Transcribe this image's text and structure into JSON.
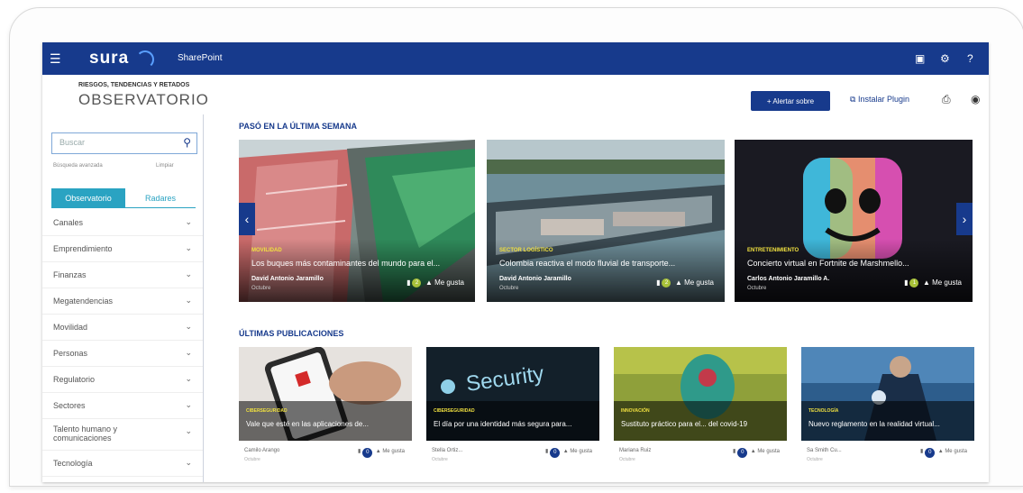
{
  "topbar": {
    "brand": "sura",
    "product": "SharePoint",
    "waffle_icon": "waffle-icon",
    "icons": [
      "mobile-icon",
      "settings-icon",
      "help-icon"
    ]
  },
  "header": {
    "subtitle": "RIESGOS, TENDENCIAS Y RETADOS",
    "title": "OBSERVATORIO",
    "primary_button": "+ Alertar sobre",
    "install_link": "Instalar Plugin"
  },
  "sidebar": {
    "search_placeholder": "Buscar",
    "advanced": "Búsqueda avanzada",
    "advanced_right": "Limpiar",
    "tabs": [
      "Observatorio",
      "Radares"
    ],
    "categories": [
      "Canales",
      "Emprendimiento",
      "Finanzas",
      "Megatendencias",
      "Movilidad",
      "Personas",
      "Regulatorio",
      "Sectores",
      "Talento humano y comunicaciones",
      "Tecnología"
    ]
  },
  "main": {
    "section1_title": "PASÓ EN LA ÚLTIMA SEMANA",
    "featured": [
      {
        "tag": "MOVILIDAD",
        "title": "Los buques más contaminantes del mundo para el...",
        "author": "David Antonio Jaramillo",
        "date": "Octubre",
        "comments": "2",
        "likes": "Me gusta"
      },
      {
        "tag": "SECTOR LOGÍSTICO",
        "title": "Colombia reactiva el modo fluvial de transporte...",
        "author": "David Antonio Jaramillo",
        "date": "Octubre",
        "comments": "2",
        "likes": "Me gusta"
      },
      {
        "tag": "ENTRETENIMIENTO",
        "title": "Concierto virtual en Fortnite de Marshmello...",
        "author": "Carlos Antonio Jaramillo A.",
        "date": "Octubre",
        "comments": "1",
        "likes": "Me gusta"
      }
    ],
    "section2_title": "ÚLTIMAS PUBLICACIONES",
    "recent": [
      {
        "tag": "CIBERSEGURIDAD",
        "title": "Vale que esté en las aplicaciones de...",
        "author": "Camilo Arango",
        "date": "Octubre",
        "comments": "0",
        "likes": "Me gusta"
      },
      {
        "tag": "CIBERSEGURIDAD",
        "title": "El día por una identidad más segura para...",
        "author": "Stella Ortiz...",
        "date": "Octubre",
        "comments": "0",
        "likes": "Me gusta"
      },
      {
        "tag": "INNOVACIÓN",
        "title": "Sustituto práctico para el... del covid-19",
        "author": "Mariana Ruiz",
        "date": "Octubre",
        "comments": "0",
        "likes": "Me gusta"
      },
      {
        "tag": "TECNOLOGÍA",
        "title": "Nuevo reglamento en la realidad virtual...",
        "author": "Sa Smith Cu...",
        "date": "Octubre",
        "comments": "0",
        "likes": "Me gusta"
      }
    ],
    "security_word": "Security"
  }
}
